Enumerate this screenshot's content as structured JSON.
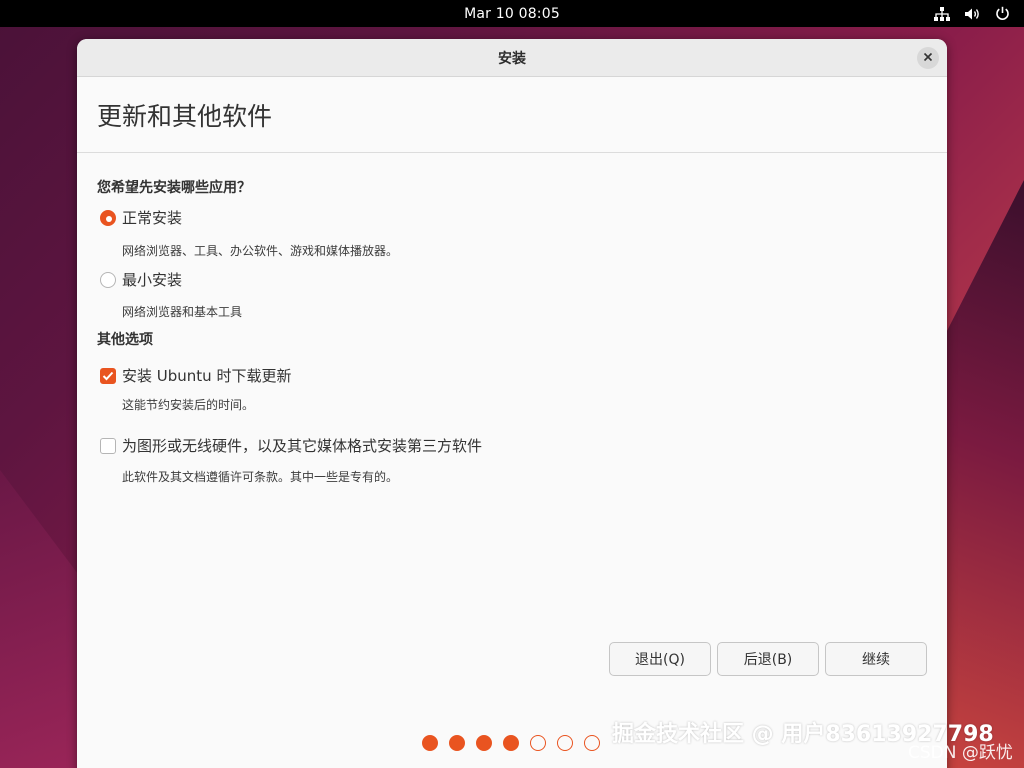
{
  "topbar": {
    "clock": "Mar 10  08:05",
    "icons": [
      "network-icon",
      "volume-icon",
      "power-icon"
    ]
  },
  "window": {
    "title": "安装",
    "close_icon": "close-icon"
  },
  "page": {
    "heading": "更新和其他软件"
  },
  "install_type": {
    "question": "您希望先安装哪些应用？",
    "options": [
      {
        "label": "正常安装",
        "description": "网络浏览器、工具、办公软件、游戏和媒体播放器。",
        "selected": true
      },
      {
        "label": "最小安装",
        "description": "网络浏览器和基本工具",
        "selected": false
      }
    ]
  },
  "other_options": {
    "title": "其他选项",
    "items": [
      {
        "label": "安装 Ubuntu 时下载更新",
        "description": "这能节约安装后的时间。",
        "checked": true
      },
      {
        "label": "为图形或无线硬件，以及其它媒体格式安装第三方软件",
        "description": "此软件及其文档遵循许可条款。其中一些是专有的。",
        "checked": false
      }
    ]
  },
  "buttons": {
    "quit": "退出(Q)",
    "back": "后退(B)",
    "continue": "继续"
  },
  "progress": {
    "total_steps": 7,
    "completed_steps": 4
  },
  "colors": {
    "accent": "#e95420"
  },
  "watermark": {
    "main": "掘金技术社区 @ 用户83613927798",
    "sub": "CSDN @跃忧"
  }
}
